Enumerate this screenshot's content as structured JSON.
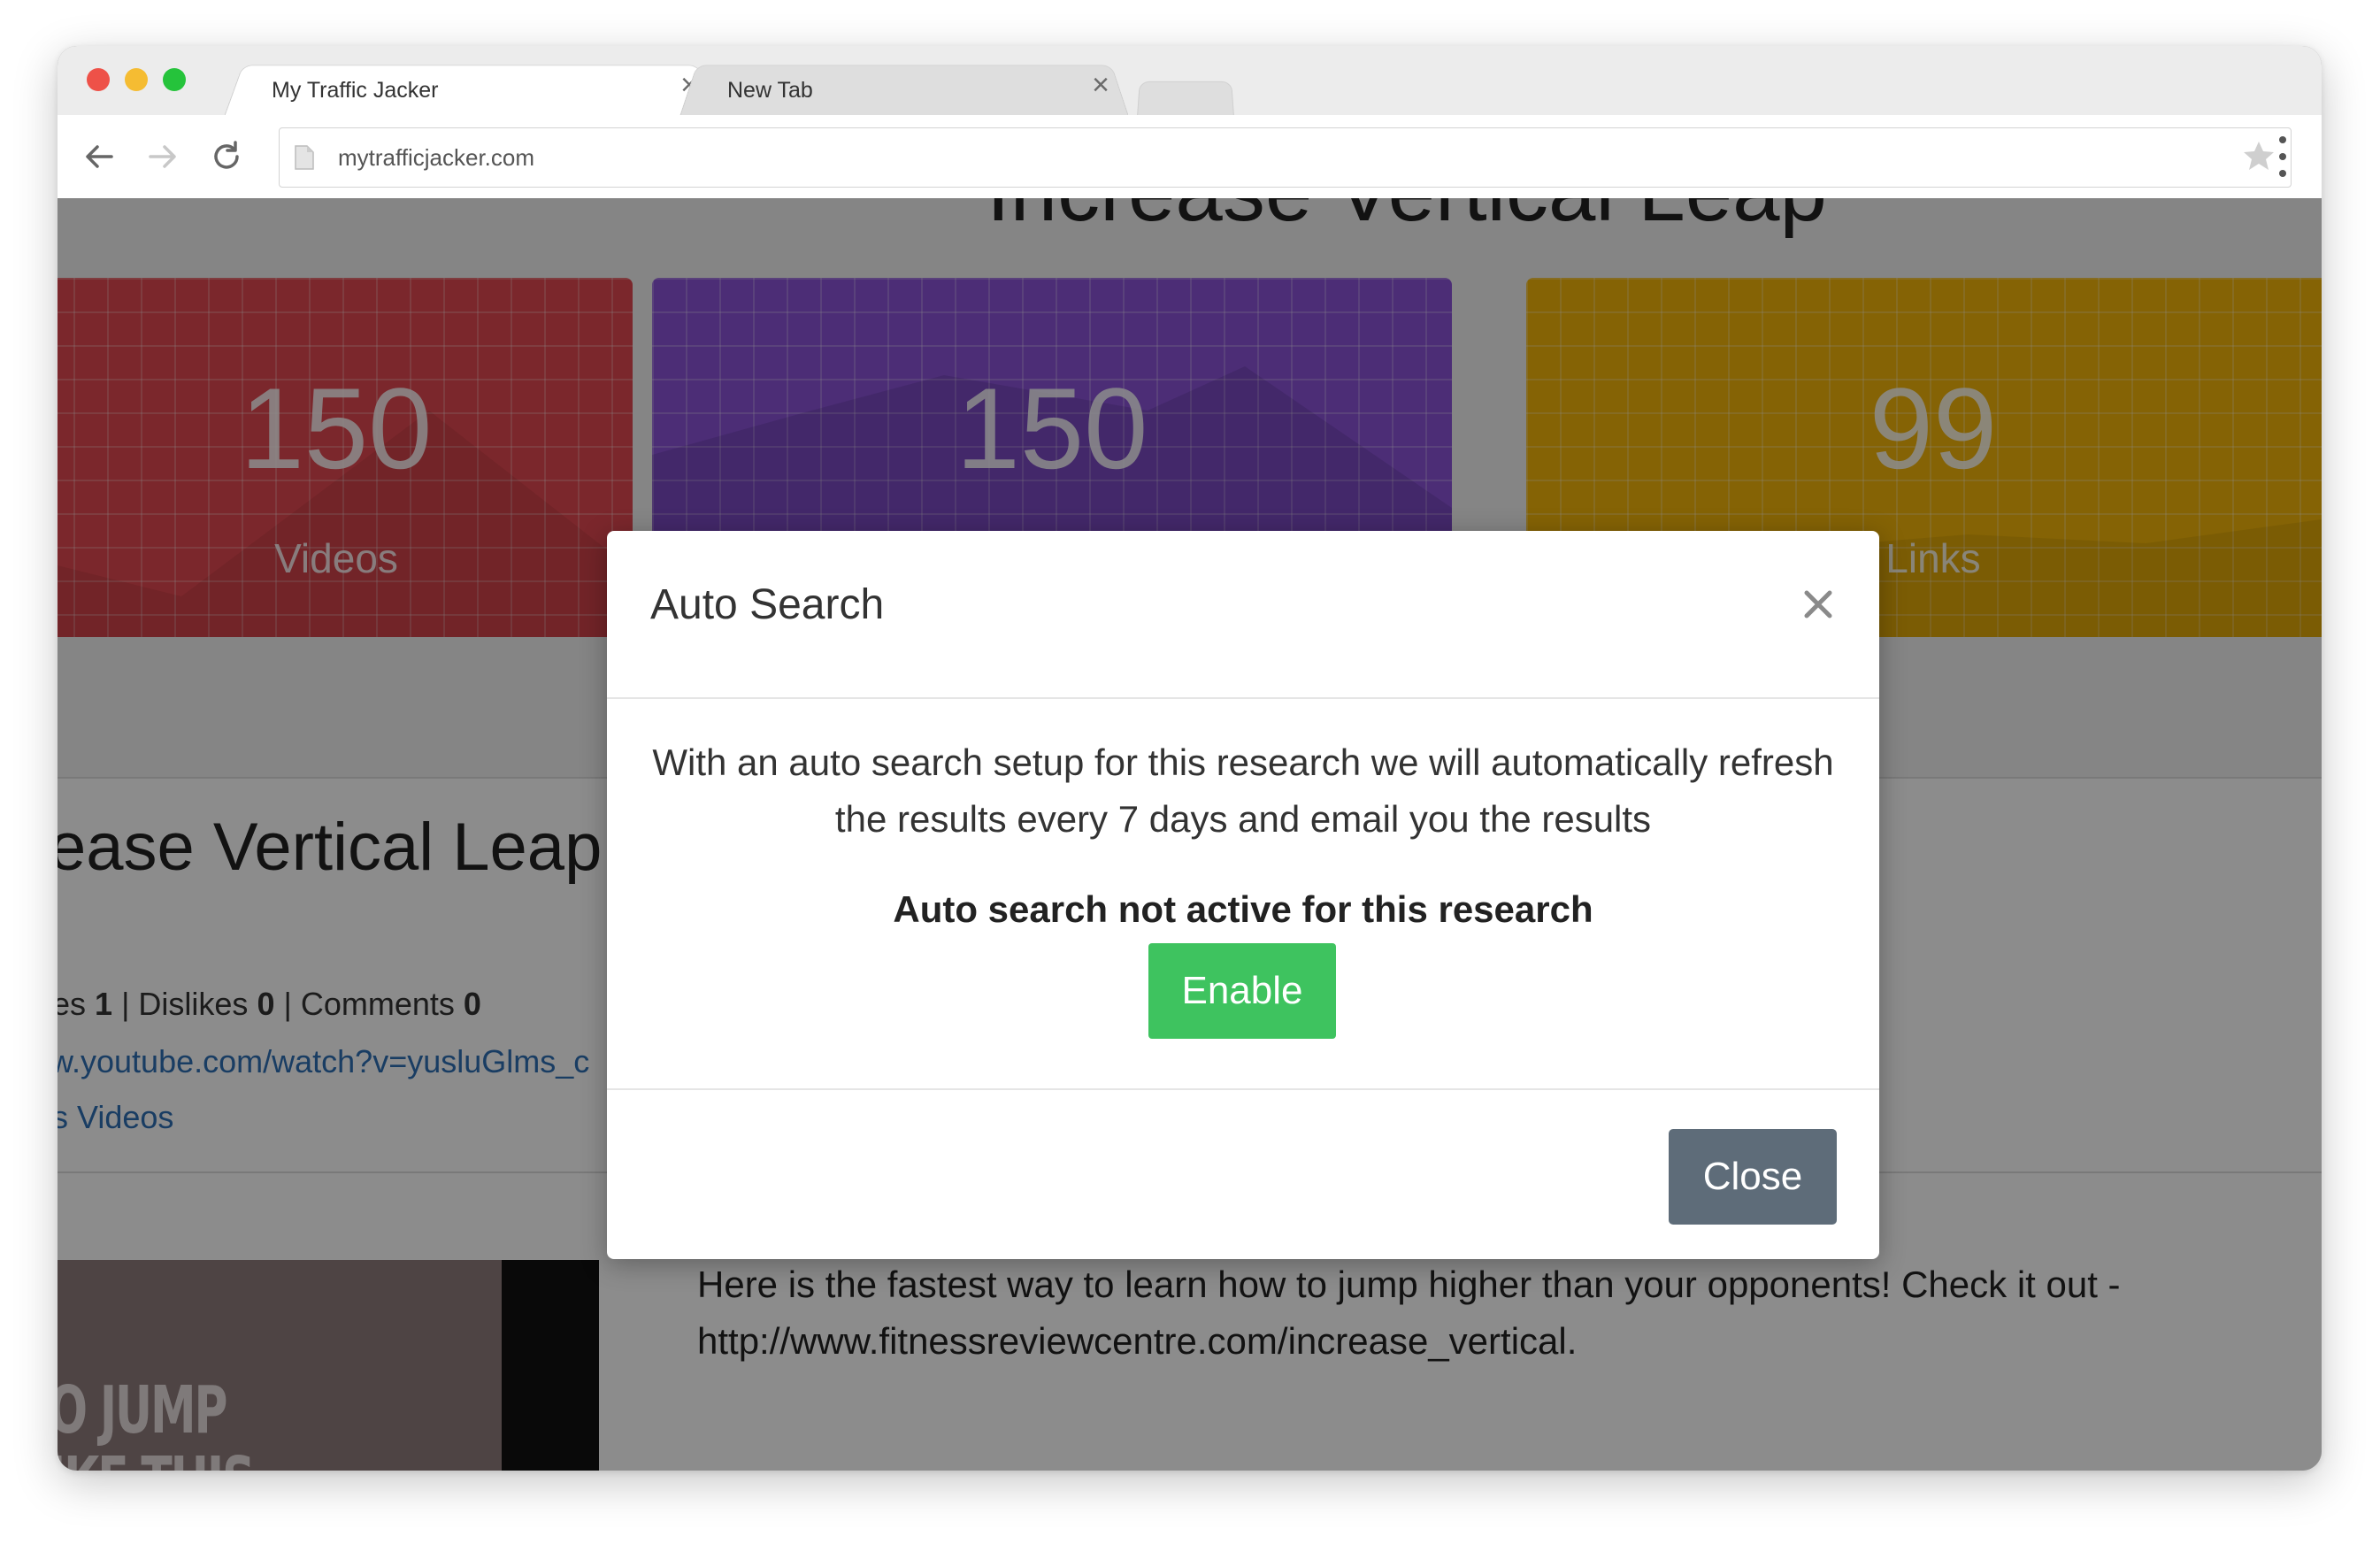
{
  "browser": {
    "tabs": [
      {
        "title": "My Traffic Jacker"
      },
      {
        "title": "New Tab"
      }
    ],
    "url": "mytrafficjacker.com"
  },
  "page": {
    "heading_partial": "Increase Vertical Leap",
    "stats": [
      {
        "value": "150",
        "label": "Videos",
        "color": "#e04850"
      },
      {
        "value": "150",
        "label": "",
        "color": "#8a52d8"
      },
      {
        "value": "99",
        "label": "Links",
        "color": "#f2b50a"
      }
    ],
    "video": {
      "title": "ease Vertical Leap",
      "meta_prefix": "es ",
      "likes": "1",
      "dislikes_label": " | Dislikes ",
      "dislikes": "0",
      "comments_label": " | Comments ",
      "comments": "0",
      "link": "w.youtube.com/watch?v=yusluGlms_c",
      "category": "s Videos",
      "thumbnail_text_1": "O JUMP",
      "thumbnail_text_2": "IKE THIS",
      "description": "Here is the fastest way to learn how to jump higher than your opponents! Check it out - http://www.fitnessreviewcentre.com/increase_vertical."
    }
  },
  "modal": {
    "title": "Auto Search",
    "body": "With an auto search setup for this research we will automatically refresh the results every 7 days and email you the results",
    "status": "Auto search not active for this research",
    "enable_label": "Enable",
    "close_label": "Close"
  }
}
